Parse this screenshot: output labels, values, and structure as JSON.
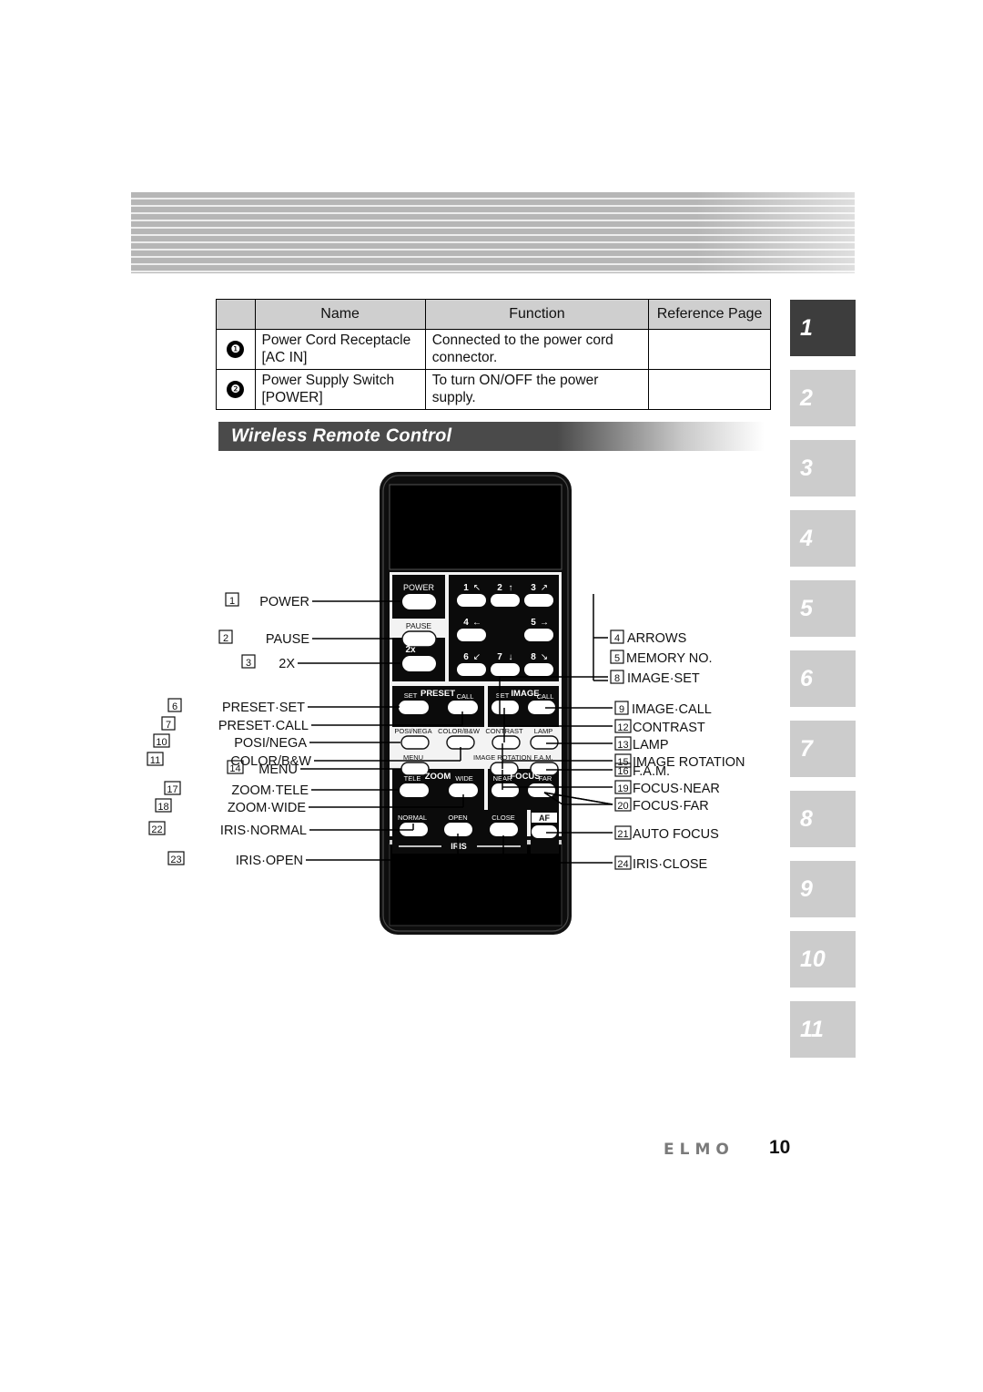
{
  "table": {
    "headers": [
      "",
      "Name",
      "Function",
      "Reference Page"
    ],
    "rows": [
      {
        "num": "❶",
        "name_line1": "Power Cord Receptacle",
        "name_line2": "[AC IN]",
        "function": "Connected to the power cord connector.",
        "reference": ""
      },
      {
        "num": "❷",
        "name_line1": "Power Supply Switch",
        "name_line2": "[POWER]",
        "function": "To turn ON/OFF the power supply.",
        "reference": ""
      }
    ]
  },
  "section": {
    "title": "Wireless Remote Control"
  },
  "tabs": [
    {
      "label": "1",
      "active": true
    },
    {
      "label": "2",
      "active": false
    },
    {
      "label": "3",
      "active": false
    },
    {
      "label": "4",
      "active": false
    },
    {
      "label": "5",
      "active": false
    },
    {
      "label": "6",
      "active": false
    },
    {
      "label": "7",
      "active": false
    },
    {
      "label": "8",
      "active": false
    },
    {
      "label": "9",
      "active": false
    },
    {
      "label": "10",
      "active": false
    },
    {
      "label": "11",
      "active": false
    }
  ],
  "footer": {
    "logo": "ELMO",
    "page": "10"
  },
  "diagram": {
    "title": "Wireless Remote Control callout diagram",
    "callouts_left": [
      {
        "num": "1",
        "label": "POWER"
      },
      {
        "num": "2",
        "label": "PAUSE"
      },
      {
        "num": "3",
        "label": "2X"
      },
      {
        "num": "6",
        "label": "PRESET·SET"
      },
      {
        "num": "7",
        "label": "PRESET·CALL"
      },
      {
        "num": "10",
        "label": "POSI/NEGA"
      },
      {
        "num": "11",
        "label": "COLOR/B&W"
      },
      {
        "num": "14",
        "label": "MENU"
      },
      {
        "num": "17",
        "label": "ZOOM·TELE"
      },
      {
        "num": "18",
        "label": "ZOOM·WIDE"
      },
      {
        "num": "22",
        "label": "IRIS·NORMAL"
      },
      {
        "num": "23",
        "label": "IRIS·OPEN"
      }
    ],
    "callouts_right": [
      {
        "num": "4",
        "label": "ARROWS"
      },
      {
        "num": "5",
        "label": "MEMORY NO."
      },
      {
        "num": "8",
        "label": "IMAGE·SET"
      },
      {
        "num": "9",
        "label": "IMAGE·CALL"
      },
      {
        "num": "12",
        "label": "CONTRAST"
      },
      {
        "num": "13",
        "label": "LAMP"
      },
      {
        "num": "15",
        "label": "IMAGE ROTATION"
      },
      {
        "num": "16",
        "label": "F.A.M."
      },
      {
        "num": "19",
        "label": "FOCUS·NEAR"
      },
      {
        "num": "20",
        "label": "FOCUS·FAR"
      },
      {
        "num": "21",
        "label": "AUTO FOCUS"
      },
      {
        "num": "24",
        "label": "IRIS·CLOSE"
      }
    ],
    "remote_buttons": {
      "power": "POWER",
      "pause": "PAUSE",
      "twox": "2x",
      "keypad": [
        {
          "key": "1",
          "arrow": "↖"
        },
        {
          "key": "2",
          "arrow": "↑"
        },
        {
          "key": "3",
          "arrow": "↗"
        },
        {
          "key": "4",
          "arrow": "←"
        },
        {
          "key": "5",
          "arrow": "→"
        },
        {
          "key": "6",
          "arrow": "↙"
        },
        {
          "key": "7",
          "arrow": "↓"
        },
        {
          "key": "8",
          "arrow": "↘"
        }
      ],
      "preset_set": "SET",
      "preset_title": "PRESET",
      "preset_call": "CALL",
      "image_set": "SET",
      "image_title": "IMAGE",
      "image_call": "CALL",
      "posi_nega": "POSI/NEGA",
      "color_bw": "COLOR/B&W",
      "contrast": "CONTRAST",
      "lamp": "LAMP",
      "menu": "MENU",
      "image_rotation": "IMAGE ROTATION",
      "fam": "F.A.M.",
      "zoom_tele": "TELE",
      "zoom_title": "ZOOM",
      "zoom_wide": "WIDE",
      "focus_near": "NEAR",
      "focus_title": "FOCUS",
      "focus_far": "FAR",
      "iris_normal": "NORMAL",
      "iris_open": "OPEN",
      "iris_close": "CLOSE",
      "iris_title": "IRIS",
      "af": "AF"
    }
  }
}
